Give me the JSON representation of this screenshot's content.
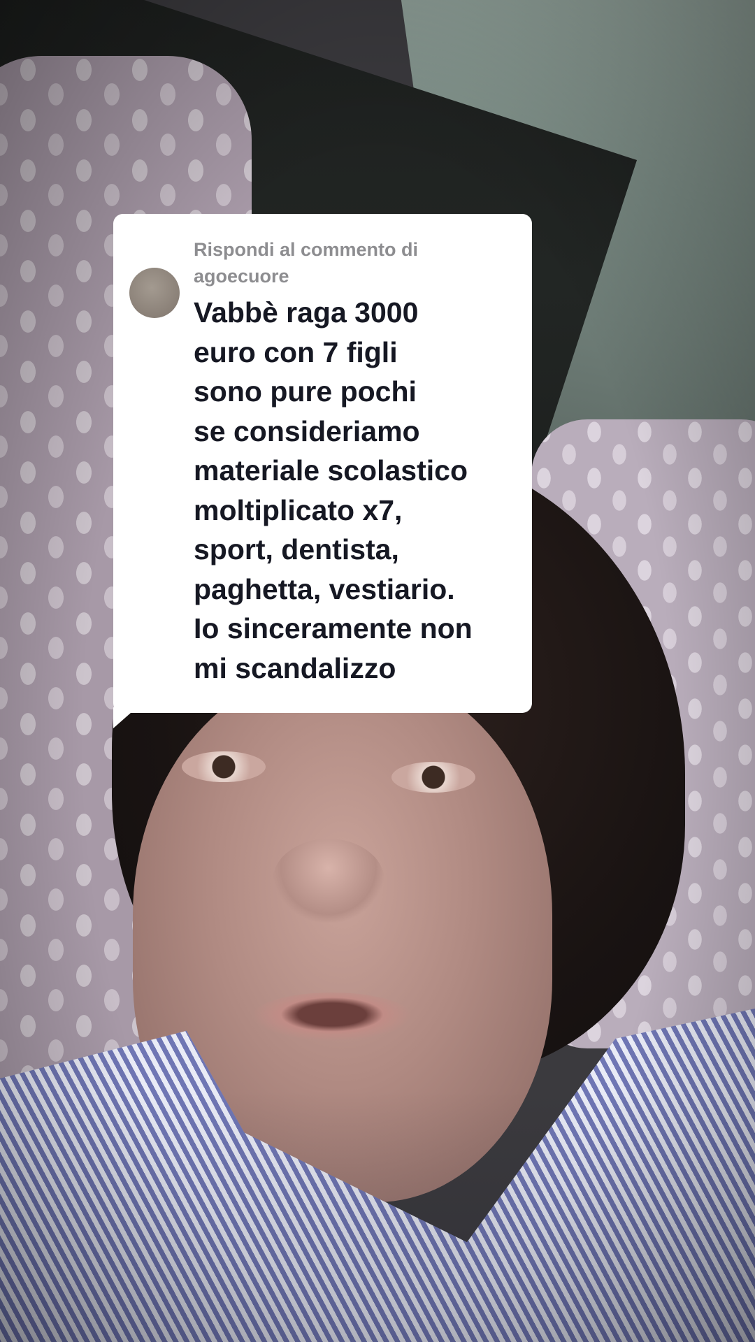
{
  "reply_sticker": {
    "header_prefix": "Rispondi al commento di",
    "username": "agoecuore",
    "comment_lines": [
      "Vabbè raga 3000",
      "euro con 7 figli",
      "sono pure pochi",
      "se consideriamo",
      "materiale scolastico",
      "moltiplicato x7,",
      "sport, dentista,",
      "paghetta, vestiario.",
      "Io sinceramente non",
      "mi scandalizzo"
    ]
  },
  "colors": {
    "card_background": "#ffffff",
    "header_text": "#8d8d90",
    "comment_text": "#161823"
  }
}
